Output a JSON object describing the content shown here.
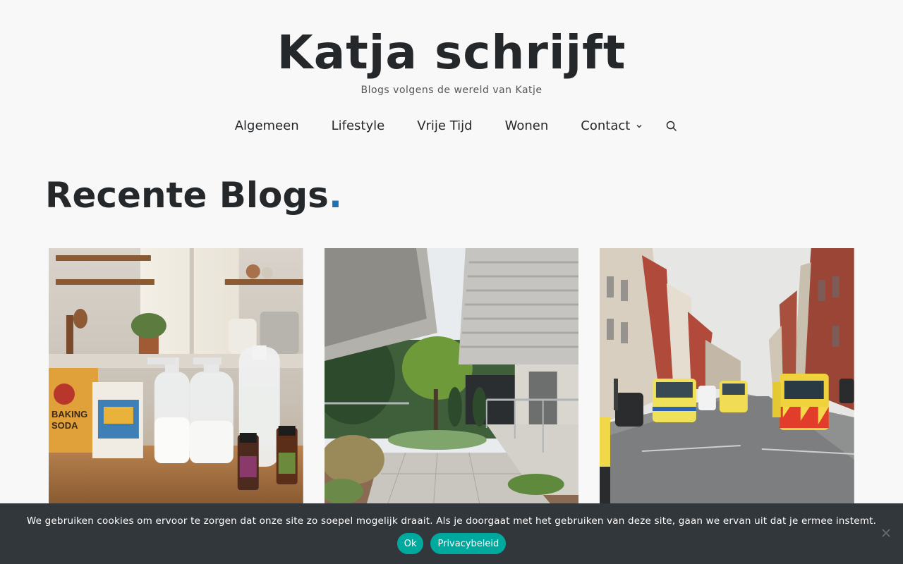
{
  "header": {
    "title": "Katja schrijft",
    "tagline": "Blogs volgens de wereld van Katje"
  },
  "nav": {
    "items": [
      {
        "label": "Algemeen"
      },
      {
        "label": "Lifestyle"
      },
      {
        "label": "Vrije Tijd"
      },
      {
        "label": "Wonen"
      },
      {
        "label": "Contact",
        "has_dropdown": true
      }
    ],
    "search_icon": "search-icon"
  },
  "main": {
    "section_title": "Recente Blogs",
    "section_title_dot": ".",
    "accent_color": "#1f6fb4",
    "cards": [
      {
        "image": "kitchen-cleaning-products-photo"
      },
      {
        "image": "garden-terrace-photo"
      },
      {
        "image": "street-ambulances-photo"
      }
    ]
  },
  "cookie": {
    "text": "We gebruiken cookies om ervoor te zorgen dat onze site zo soepel mogelijk draait. Als je doorgaat met het gebruiken van deze site, gaan we ervan uit dat je ermee instemt.",
    "ok_label": "Ok",
    "privacy_label": "Privacybeleid",
    "button_color": "#00a99d",
    "background": "#32373c"
  }
}
